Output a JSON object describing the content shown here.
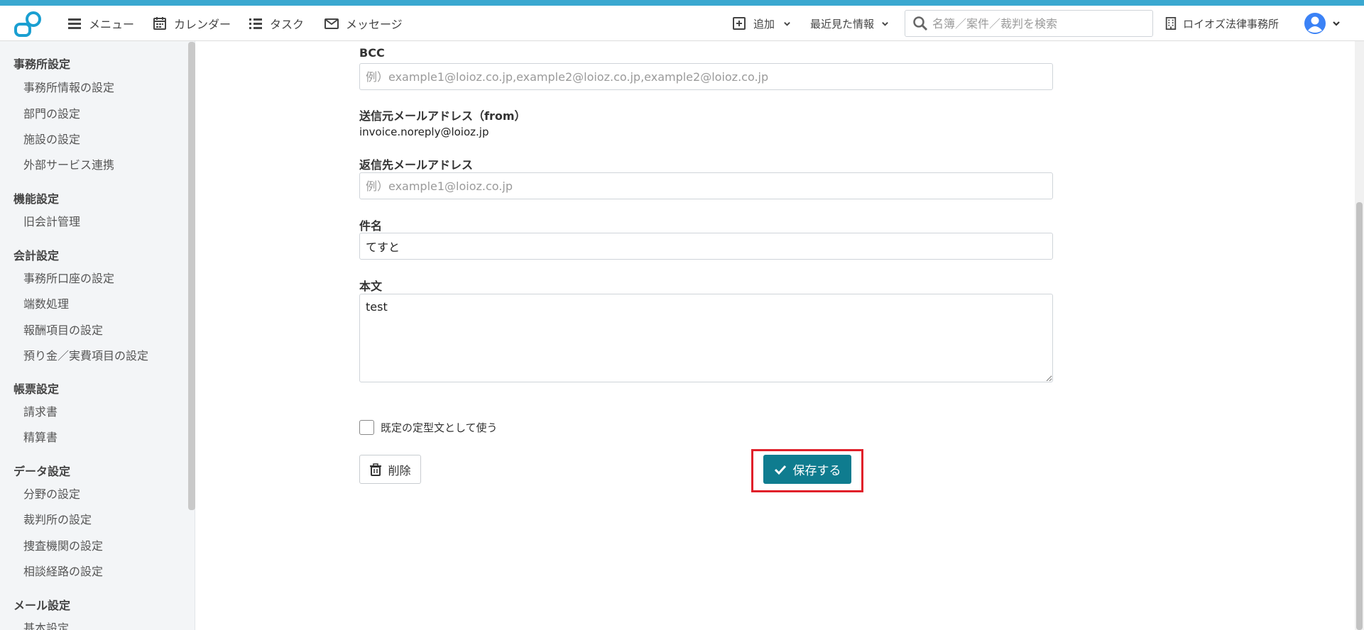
{
  "header": {
    "menu_label": "メニュー",
    "calendar_label": "カレンダー",
    "tasks_label": "タスク",
    "messages_label": "メッセージ",
    "add_label": "追加",
    "recent_label": "最近見た情報",
    "search_placeholder": "名簿／案件／裁判を検索",
    "office_name": "ロイオズ法律事務所"
  },
  "sidebar": {
    "groups": [
      {
        "title": "事務所設定",
        "items": [
          "事務所情報の設定",
          "部門の設定",
          "施設の設定",
          "外部サービス連携"
        ]
      },
      {
        "title": "機能設定",
        "items": [
          "旧会計管理"
        ]
      },
      {
        "title": "会計設定",
        "items": [
          "事務所口座の設定",
          "端数処理",
          "報酬項目の設定",
          "預り金／実費項目の設定"
        ]
      },
      {
        "title": "帳票設定",
        "items": [
          "請求書",
          "精算書"
        ]
      },
      {
        "title": "データ設定",
        "items": [
          "分野の設定",
          "裁判所の設定",
          "捜査機関の設定",
          "相談経路の設定"
        ]
      },
      {
        "title": "メール設定",
        "items": [
          "基本設定"
        ]
      }
    ]
  },
  "form": {
    "bcc_label": "BCC",
    "bcc_placeholder": "例）example1@loioz.co.jp,example2@loioz.co.jp,example2@loioz.co.jp",
    "from_label": "送信元メールアドレス（from）",
    "from_value": "invoice.noreply@loioz.jp",
    "reply_label": "返信先メールアドレス",
    "reply_placeholder": "例）example1@loioz.co.jp",
    "subject_label": "件名",
    "subject_value": "てすと",
    "body_label": "本文",
    "body_value": "test",
    "default_checkbox_label": "既定の定型文として使う",
    "delete_label": "削除",
    "save_label": "保存する"
  },
  "colors": {
    "accent_stripe": "#3aa8d0",
    "save_button": "#0f7c8f",
    "highlight_box": "#e0202a",
    "logo": "#1a9fd1",
    "avatar": "#3b82f6"
  }
}
